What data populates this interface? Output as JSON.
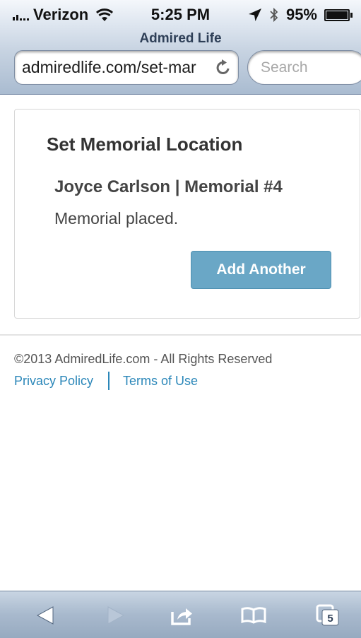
{
  "status_bar": {
    "carrier": "Verizon",
    "time": "5:25 PM",
    "battery": "95%"
  },
  "browser": {
    "page_title": "Admired Life",
    "url": "admiredlife.com/set-mar",
    "search_placeholder": "Search",
    "tab_count": "5"
  },
  "card": {
    "title": "Set Memorial Location",
    "subtitle": "Joyce Carlson | Memorial #4",
    "message": "Memorial placed.",
    "button_label": "Add Another"
  },
  "footer": {
    "copyright": "©2013 AdmiredLife.com - All Rights Reserved",
    "privacy_label": "Privacy Policy",
    "terms_label": "Terms of Use"
  },
  "colors": {
    "accent_button": "#6aa7c6",
    "link": "#2b87b9"
  },
  "icons": [
    "signal-icon",
    "wifi-icon",
    "location-arrow-icon",
    "bluetooth-icon",
    "battery-icon",
    "reload-icon",
    "back-icon",
    "forward-icon",
    "share-icon",
    "bookmarks-icon",
    "tabs-icon"
  ]
}
